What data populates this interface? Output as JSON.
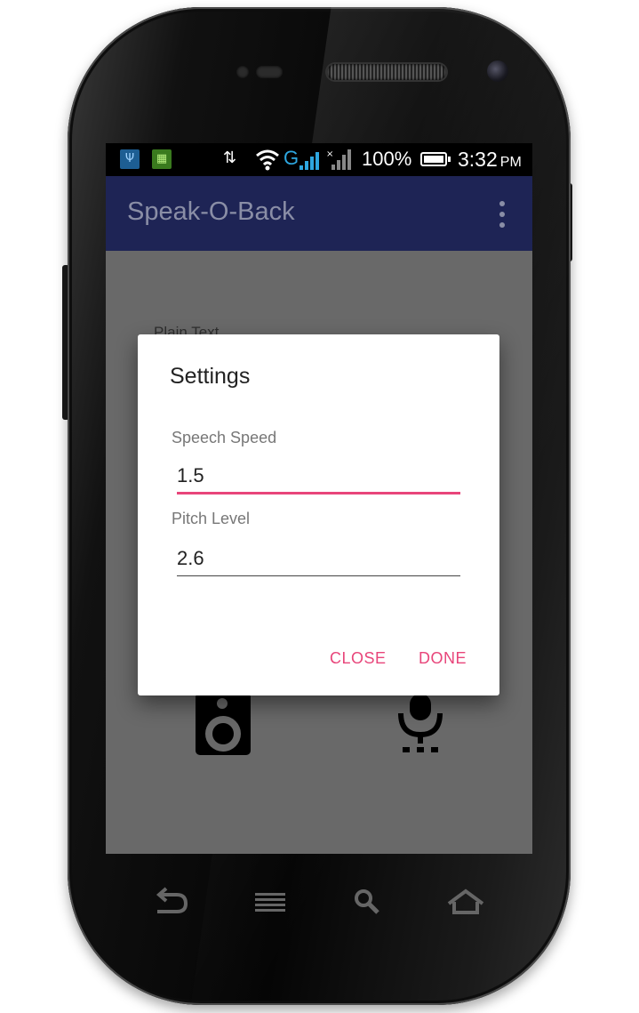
{
  "status_bar": {
    "battery_percent": "100%",
    "time": "3:32",
    "ampm": "PM",
    "network_label": "G"
  },
  "app_bar": {
    "title": "Speak-O-Back"
  },
  "background": {
    "plain_text_label": "Plain Text"
  },
  "dialog": {
    "title": "Settings",
    "speech_speed": {
      "label": "Speech Speed",
      "value": "1.5"
    },
    "pitch_level": {
      "label": "Pitch Level",
      "value": "2.6"
    },
    "close_label": "CLOSE",
    "done_label": "DONE"
  },
  "colors": {
    "app_bar": "#1e2455",
    "accent": "#e8457a",
    "scrim": "#696969"
  },
  "icons": {
    "usb": "usb-icon",
    "android_debug": "android-icon",
    "data_transfer": "data-arrows-icon",
    "wifi": "wifi-icon",
    "signal": "signal-icon",
    "battery": "battery-icon",
    "overflow": "overflow-menu-icon",
    "speaker": "speaker-icon",
    "microphone": "microphone-icon",
    "back": "back-icon",
    "recent": "recent-apps-icon",
    "search": "search-icon",
    "home": "home-icon"
  }
}
